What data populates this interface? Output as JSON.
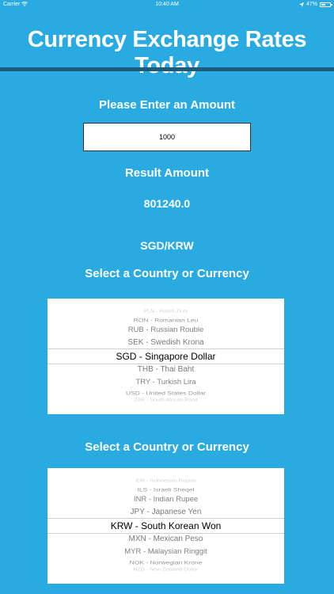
{
  "status_bar": {
    "carrier": "Carrier",
    "time": "10:40 AM",
    "battery": "47%",
    "battery_level": 0.47,
    "wifi_icon": "wifi-icon",
    "location_icon": "location-arrow-icon"
  },
  "header": {
    "title": "Currency Exchange Rates Today"
  },
  "amount": {
    "label": "Please Enter an Amount",
    "value": "1000"
  },
  "result": {
    "label": "Result Amount",
    "value": "801240.0"
  },
  "pair": "SGD/KRW",
  "picker_from": {
    "label": "Select a Country or Currency",
    "items": [
      "PLN - Polish Zloty",
      "RON - Romanian Leu",
      "RUB - Russian Rouble",
      "SEK - Swedish Krona",
      "SGD - Singapore Dollar",
      "THB - Thai Baht",
      "TRY - Turkish Lira",
      "USD - United States Dollar",
      "ZAR - South African Rand"
    ],
    "selected": "SGD - Singapore Dollar"
  },
  "picker_to": {
    "label": "Select a Country or Currency",
    "items": [
      "IDR - Indonesian Rupiah",
      "ILS - Israeli Sheqel",
      "INR - Indian Rupee",
      "JPY - Japanese Yen",
      "KRW - South Korean Won",
      "MXN - Mexican Peso",
      "MYR - Malaysian Ringgit",
      "NOK - Norwegian Krone",
      "NZD - New Zealand Dollar"
    ],
    "selected": "KRW - South Korean Won"
  },
  "colors": {
    "background": "#29abe2",
    "rule": "#1f5a7a",
    "text": "#ffffff"
  }
}
